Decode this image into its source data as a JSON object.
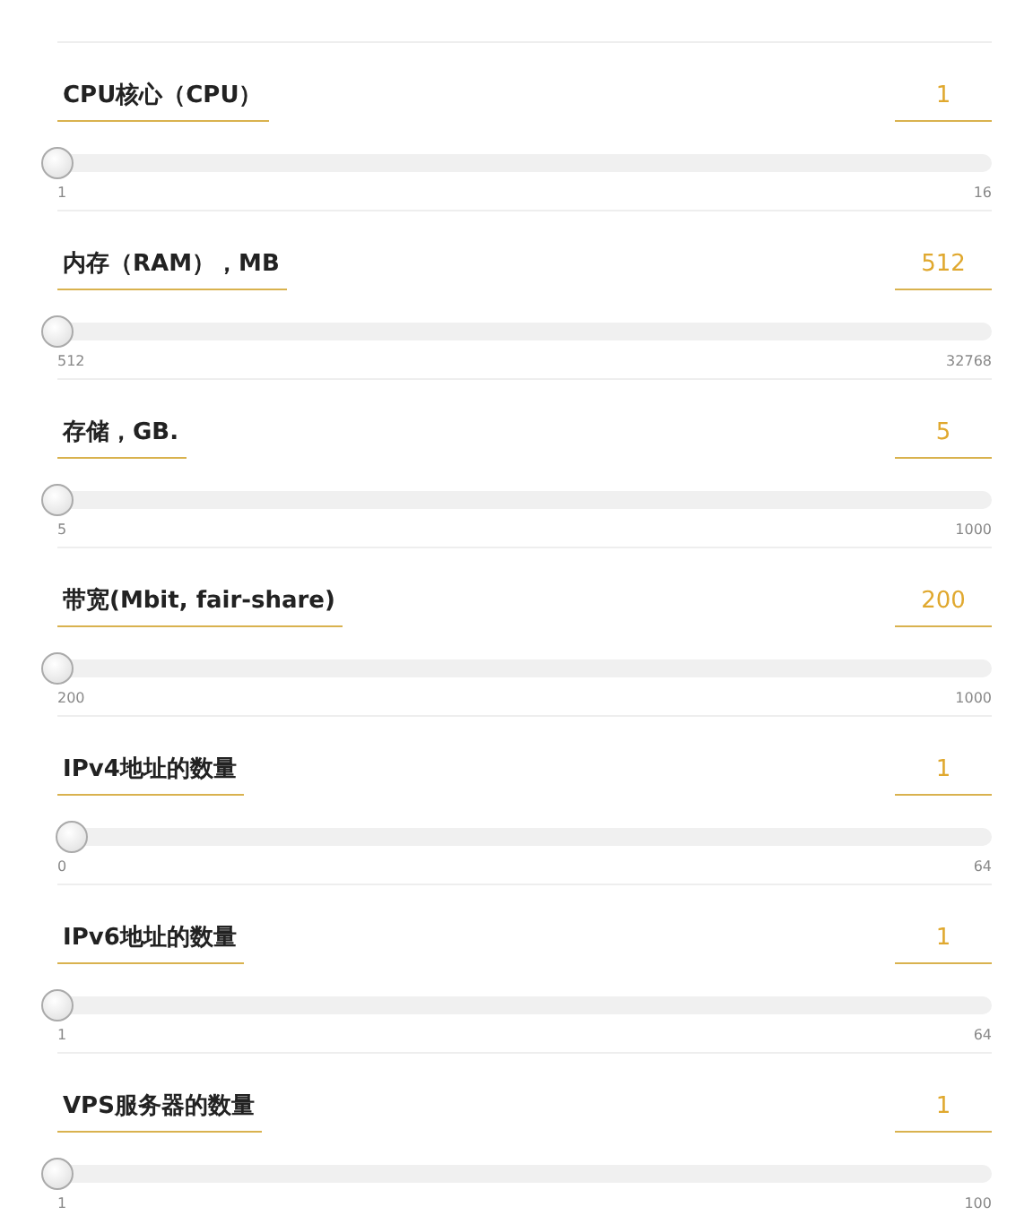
{
  "parameters": [
    {
      "label": "CPU核心（CPU）",
      "value": "1",
      "level": 0,
      "min": "1",
      "max": "16"
    },
    {
      "label": "内存（RAM），MB",
      "value": "512",
      "level": 0,
      "min": "512",
      "max": "32768"
    },
    {
      "label": "存储，GB.",
      "value": "5",
      "level": 0,
      "min": "5",
      "max": "1000"
    },
    {
      "label": "带宽(Mbit, fair-share)",
      "value": "200",
      "level": 0,
      "min": "200",
      "max": "1000"
    },
    {
      "label": "IPv4地址的数量",
      "value": "1",
      "level": 0.016,
      "min": "0",
      "max": "64"
    },
    {
      "label": "IPv6地址的数量",
      "value": "1",
      "level": 0,
      "min": "1",
      "max": "64"
    },
    {
      "label": "VPS服务器的数量",
      "value": "1",
      "level": 0,
      "min": "1",
      "max": "100"
    }
  ]
}
